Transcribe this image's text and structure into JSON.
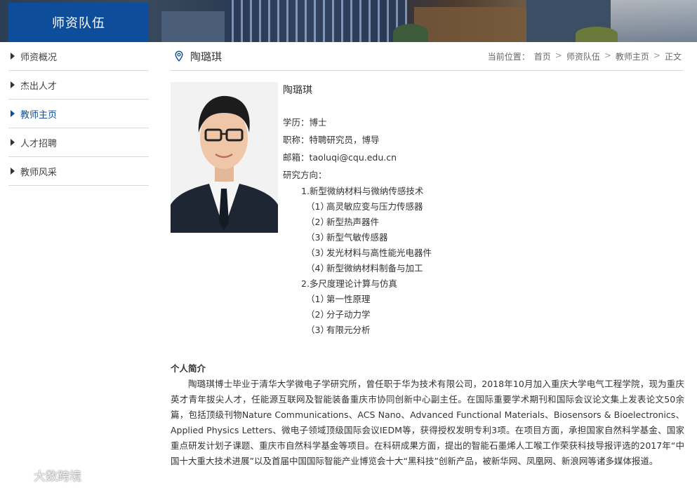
{
  "banner": {
    "section_title": "师资队伍"
  },
  "sidebar": {
    "items": [
      {
        "label": "师资概况",
        "active": false
      },
      {
        "label": "杰出人才",
        "active": false
      },
      {
        "label": "教师主页",
        "active": true
      },
      {
        "label": "人才招聘",
        "active": false
      },
      {
        "label": "教师风采",
        "active": false
      }
    ]
  },
  "header": {
    "name": "陶璐琪",
    "breadcrumb": {
      "prefix": "当前位置：",
      "items": [
        "首页",
        "师资队伍",
        "教师主页",
        "正文"
      ],
      "separator": ">"
    }
  },
  "profile": {
    "name": "陶璐琪",
    "degree": "学历：博士",
    "title": "职称：特聘研究员，博导",
    "email": "邮箱：taoluqi@cqu.edu.cn",
    "research_label": "研究方向：",
    "topics": [
      {
        "label": "1.新型微纳材料与微纳传感技术",
        "subs": [
          {
            "num": "（1）",
            "text": "高灵敏应变与压力传感器"
          },
          {
            "num": "（2）",
            "text": "新型热声器件"
          },
          {
            "num": "（3）",
            "text": "新型气敏传感器"
          },
          {
            "num": "（3）",
            "text": "发光材料与高性能光电器件"
          },
          {
            "num": "（4）",
            "text": "新型微纳材料制备与加工"
          }
        ]
      },
      {
        "label": "2.多尺度理论计算与仿真",
        "subs": [
          {
            "num": "（1）",
            "text": "第一性原理"
          },
          {
            "num": "（2）",
            "text": "分子动力学"
          },
          {
            "num": "（3）",
            "text": "有限元分析"
          }
        ]
      }
    ]
  },
  "bio": {
    "title": "个人简介",
    "text": "陶璐琪博士毕业于清华大学微电子学研究所，曾任职于华为技术有限公司，2018年10月加入重庆大学电气工程学院，现为重庆英才青年拔尖人才，任能源互联网及智能装备重庆市协同创新中心副主任。在国际重要学术期刊和国际会议论文集上发表论文50余篇，包括顶级刊物Nature Communications、ACS Nano、Advanced Functional Materials、Biosensors & Bioelectronics、Applied Physics Letters、微电子领域顶级国际会议IEDM等，获得授权发明专利3项。在项目方面，承担国家自然科学基金、国家重点研发计划子课题、重庆市自然科学基金等项目。在科研成果方面，提出的智能石墨烯人工喉工作荣获科技导报评选的2017年“中国十大重大技术进展”以及首届中国国际智能产业博览会十大“黑科技”创新产品，被新华网、凤凰网、新浪网等诸多媒体报道。"
  },
  "watermark": {
    "text": "大数跨境"
  },
  "colors": {
    "accent": "#0e4d99",
    "divider": "#d9d9d9",
    "text": "#333333"
  }
}
